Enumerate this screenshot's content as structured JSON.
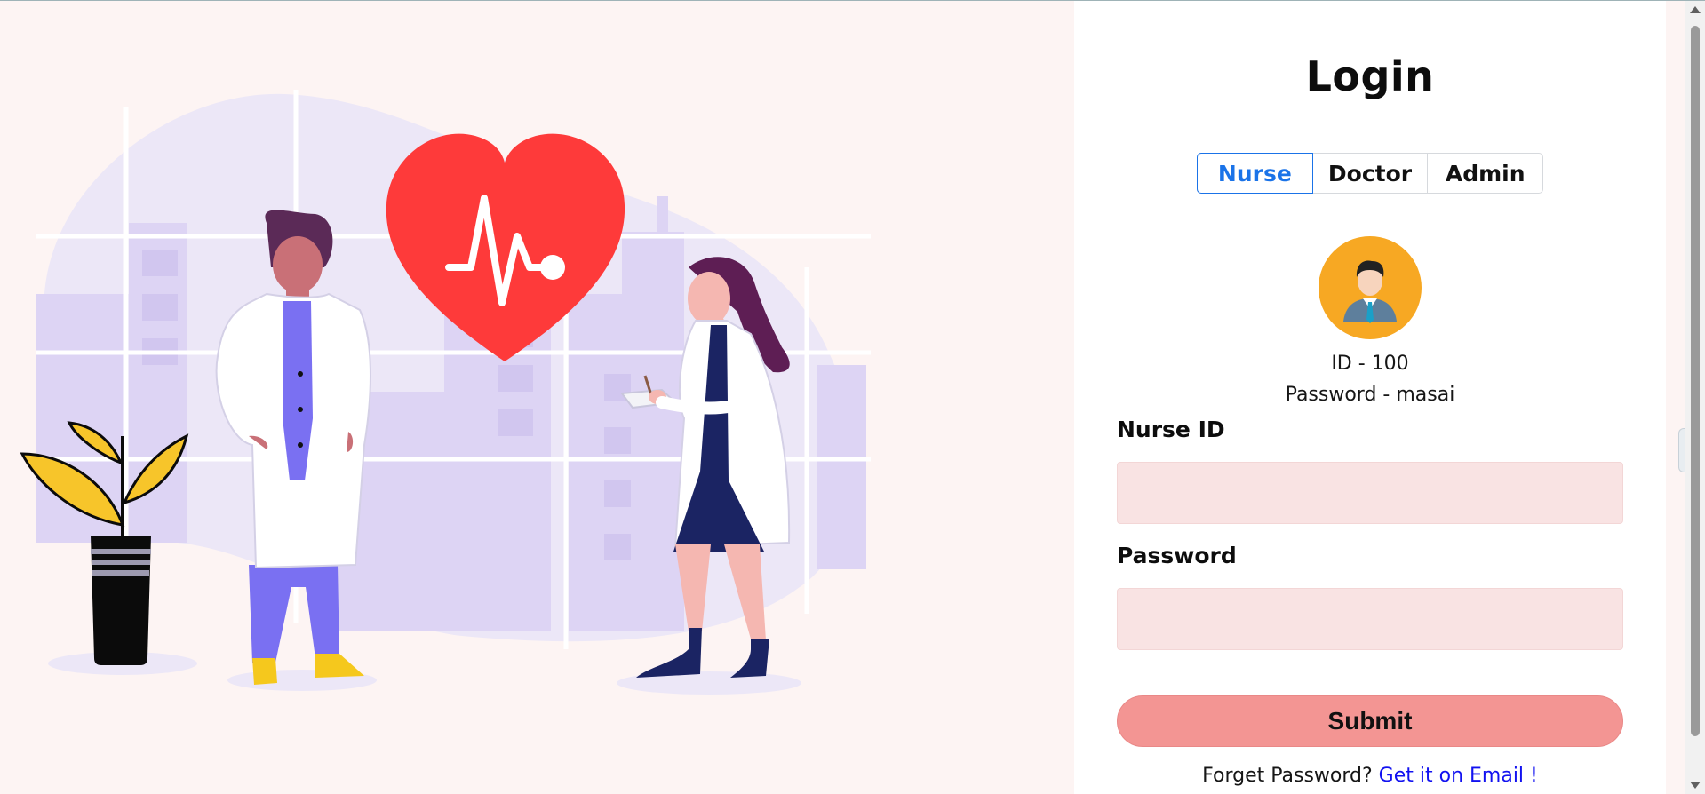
{
  "login": {
    "title": "Login",
    "tabs": [
      {
        "label": "Nurse",
        "active": true
      },
      {
        "label": "Doctor",
        "active": false
      },
      {
        "label": "Admin",
        "active": false
      }
    ],
    "credentials": {
      "id_text": "ID - 100",
      "password_text": "Password - masai"
    },
    "fields": {
      "id_label": "Nurse ID",
      "id_value": "",
      "password_label": "Password",
      "password_value": ""
    },
    "submit_label": "Submit",
    "forgot": {
      "prompt": "Forget Password?",
      "link": "Get it on Email !"
    }
  },
  "colors": {
    "accent": "#1a73e8",
    "submit": "#f39593",
    "input_bg": "#f9e3e3",
    "heart": "#fe3a3a",
    "avatar_bg": "#f7a823",
    "page_bg": "#fdf4f3",
    "link": "#1212f0"
  },
  "icons": {
    "avatar": "user-avatar-icon",
    "side_tab": "chevron-left-icon",
    "heart": "heart-pulse-icon"
  }
}
